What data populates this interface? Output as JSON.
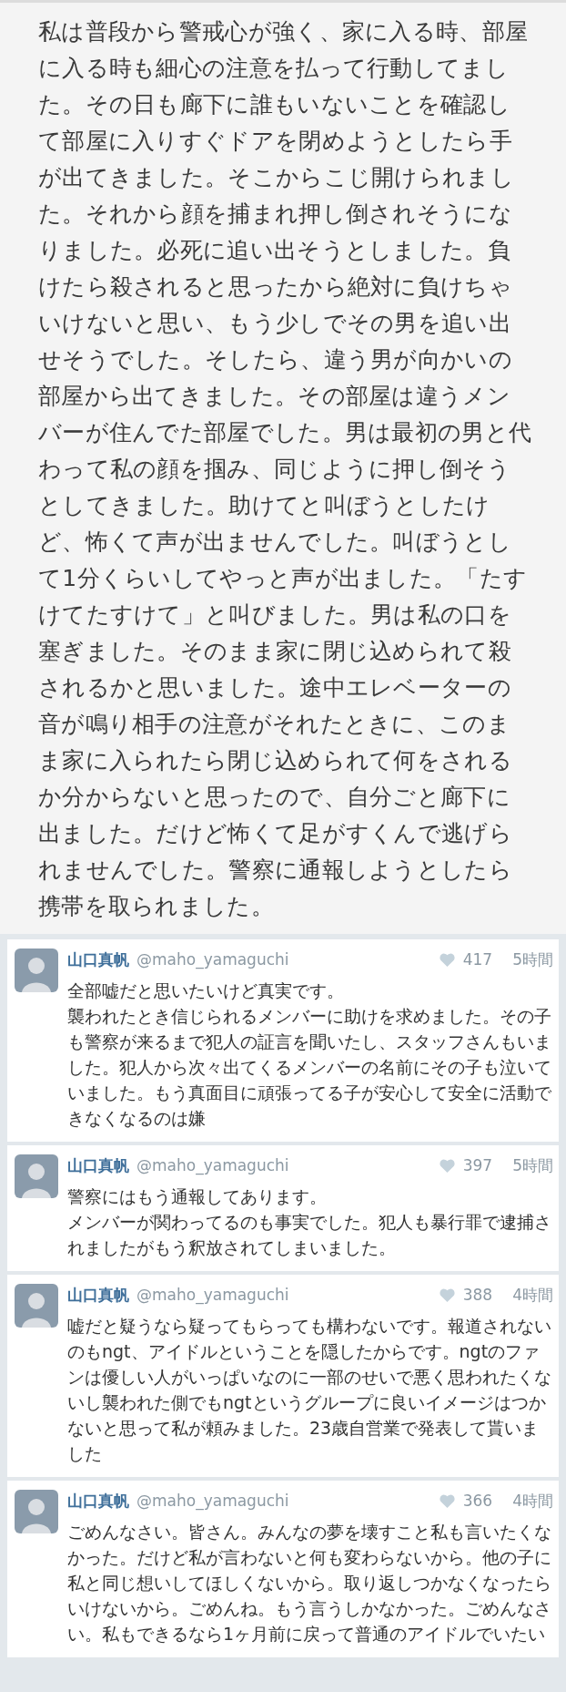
{
  "statement": "私は普段から警戒心が強く、家に入る時、部屋に入る時も細心の注意を払って行動してました。その日も廊下に誰もいないことを確認して部屋に入りすぐドアを閉めようとしたら手が出てきました。そこからこじ開けられました。それから顔を捕まれ押し倒されそうになりました。必死に追い出そうとしました。負けたら殺されると思ったから絶対に負けちゃいけないと思い、もう少しでその男を追い出せそうでした。そしたら、違う男が向かいの部屋から出てきました。その部屋は違うメンバーが住んでた部屋でした。男は最初の男と代わって私の顔を掴み、同じように押し倒そうとしてきました。助けてと叫ぼうとしたけど、怖くて声が出ませんでした。叫ぼうとして1分くらいしてやっと声が出ました。「たすけてたすけて」と叫びました。男は私の口を塞ぎました。そのまま家に閉じ込められて殺されるかと思いました。途中エレベーターの音が鳴り相手の注意がそれたときに、このまま家に入られたら閉じ込められて何をされるか分からないと思ったので、自分ごと廊下に出ました。だけど怖くて足がすくんで逃げられませんでした。警察に通報しようとしたら携帯を取られました。",
  "tweets": [
    {
      "name": "山口真帆",
      "handle": "@maho_yamaguchi",
      "likes": "417",
      "time": "5時間",
      "text": [
        "全部嘘だと思いたいけど真実です。",
        "襲われたとき信じられるメンバーに助けを求めました。その子も警察が来るまで犯人の証言を聞いたし、スタッフさんもいました。犯人から次々出てくるメンバーの名前にその子も泣いていました。もう真面目に頑張ってる子が安心して安全に活動できなくなるのは嫌"
      ]
    },
    {
      "name": "山口真帆",
      "handle": "@maho_yamaguchi",
      "likes": "397",
      "time": "5時間",
      "text": [
        "警察にはもう通報してあります。",
        "メンバーが関わってるのも事実でした。犯人も暴行罪で逮捕されましたがもう釈放されてしまいました。"
      ]
    },
    {
      "name": "山口真帆",
      "handle": "@maho_yamaguchi",
      "likes": "388",
      "time": "4時間",
      "text": [
        "嘘だと疑うなら疑ってもらっても構わないです。報道されないのもngt、アイドルということを隠したからです。ngtのファンは優しい人がいっぱいなのに一部のせいで悪く思われたくないし襲われた側でもngtというグループに良いイメージはつかないと思って私が頼みました。23歳自営業で発表して貰いました"
      ]
    },
    {
      "name": "山口真帆",
      "handle": "@maho_yamaguchi",
      "likes": "366",
      "time": "4時間",
      "text": [
        "ごめんなさい。皆さん。みんなの夢を壊すこと私も言いたくなかった。だけど私が言わないと何も変わらないから。他の子に私と同じ想いしてほしくないから。取り返しつかなくなったらいけないから。ごめんね。もう言うしかなかった。ごめんなさい。私もできるなら1ヶ月前に戻って普通のアイドルでいたい"
      ]
    }
  ]
}
